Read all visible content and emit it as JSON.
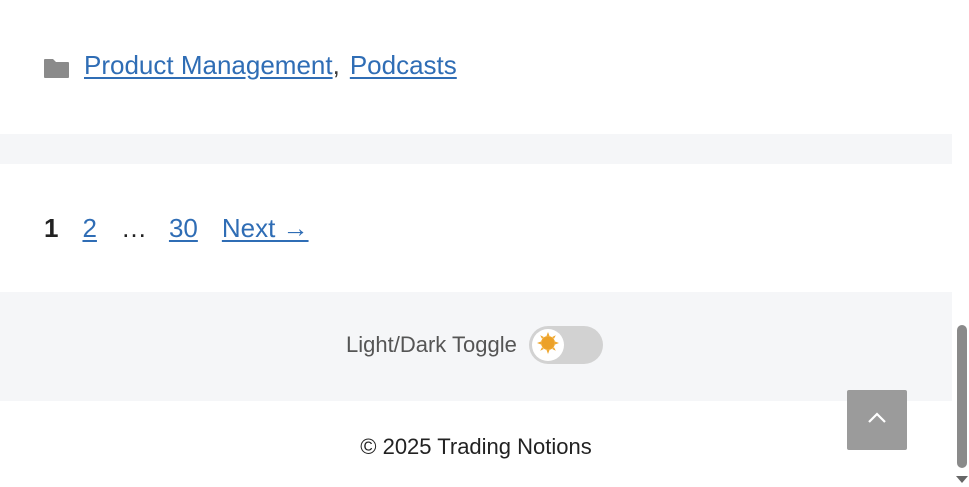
{
  "post_meta": {
    "categories_icon": "folder-icon",
    "categories": [
      {
        "label": "Product Management"
      },
      {
        "label": "Podcasts"
      }
    ],
    "separator": ","
  },
  "pagination": {
    "current": "1",
    "page_2": "2",
    "ellipsis": "…",
    "last": "30",
    "next_label": "Next →"
  },
  "footer": {
    "toggle_label": "Light/Dark Toggle",
    "toggle_icon": "sun-icon",
    "toggle_state": "light",
    "copyright": "© 2025 Trading Notions",
    "back_to_top_icon": "chevron-up-icon"
  },
  "colors": {
    "link": "#2f6db5",
    "band": "#f5f6f8",
    "toggle_track": "#d2d2d2",
    "back_to_top_bg": "#9b9b9b",
    "sun": "#f0a830"
  }
}
